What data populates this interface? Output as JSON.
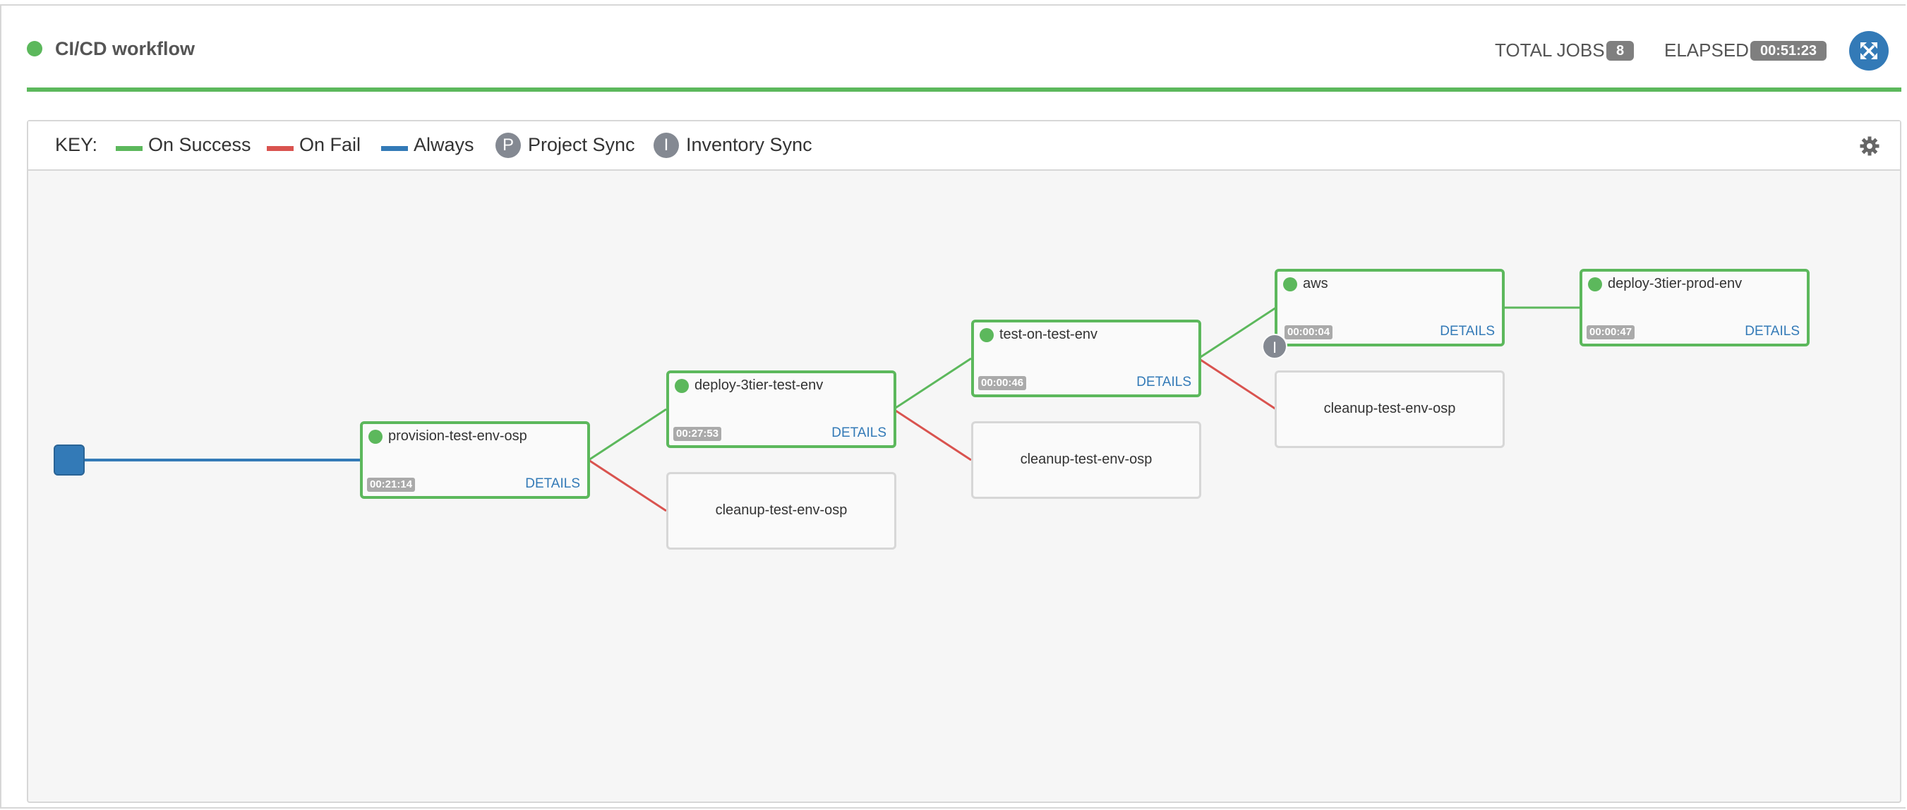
{
  "header": {
    "title": "CI/CD workflow",
    "total_jobs_label": "TOTAL JOBS",
    "total_jobs_value": "8",
    "elapsed_label": "ELAPSED",
    "elapsed_value": "00:51:23",
    "status_color": "#5cb85c",
    "expand_icon": "expand-icon"
  },
  "key": {
    "label": "KEY:",
    "on_success": "On Success",
    "on_fail": "On Fail",
    "always": "Always",
    "project_sync_badge": "P",
    "project_sync": "Project Sync",
    "inventory_sync_badge": "I",
    "inventory_sync": "Inventory Sync",
    "colors": {
      "success": "#5cb85c",
      "fail": "#d9534f",
      "always": "#337ab7"
    }
  },
  "nodes": {
    "provision": {
      "name": "provision-test-env-osp",
      "time": "00:21:14",
      "details": "DETAILS"
    },
    "deploy_test": {
      "name": "deploy-3tier-test-env",
      "time": "00:27:53",
      "details": "DETAILS"
    },
    "cleanup_1": {
      "name": "cleanup-test-env-osp"
    },
    "test_on_test": {
      "name": "test-on-test-env",
      "time": "00:00:46",
      "details": "DETAILS"
    },
    "cleanup_2": {
      "name": "cleanup-test-env-osp"
    },
    "aws": {
      "name": "aws",
      "time": "00:00:04",
      "details": "DETAILS",
      "badge": "I"
    },
    "cleanup_3": {
      "name": "cleanup-test-env-osp"
    },
    "deploy_prod": {
      "name": "deploy-3tier-prod-env",
      "time": "00:00:47",
      "details": "DETAILS"
    }
  }
}
